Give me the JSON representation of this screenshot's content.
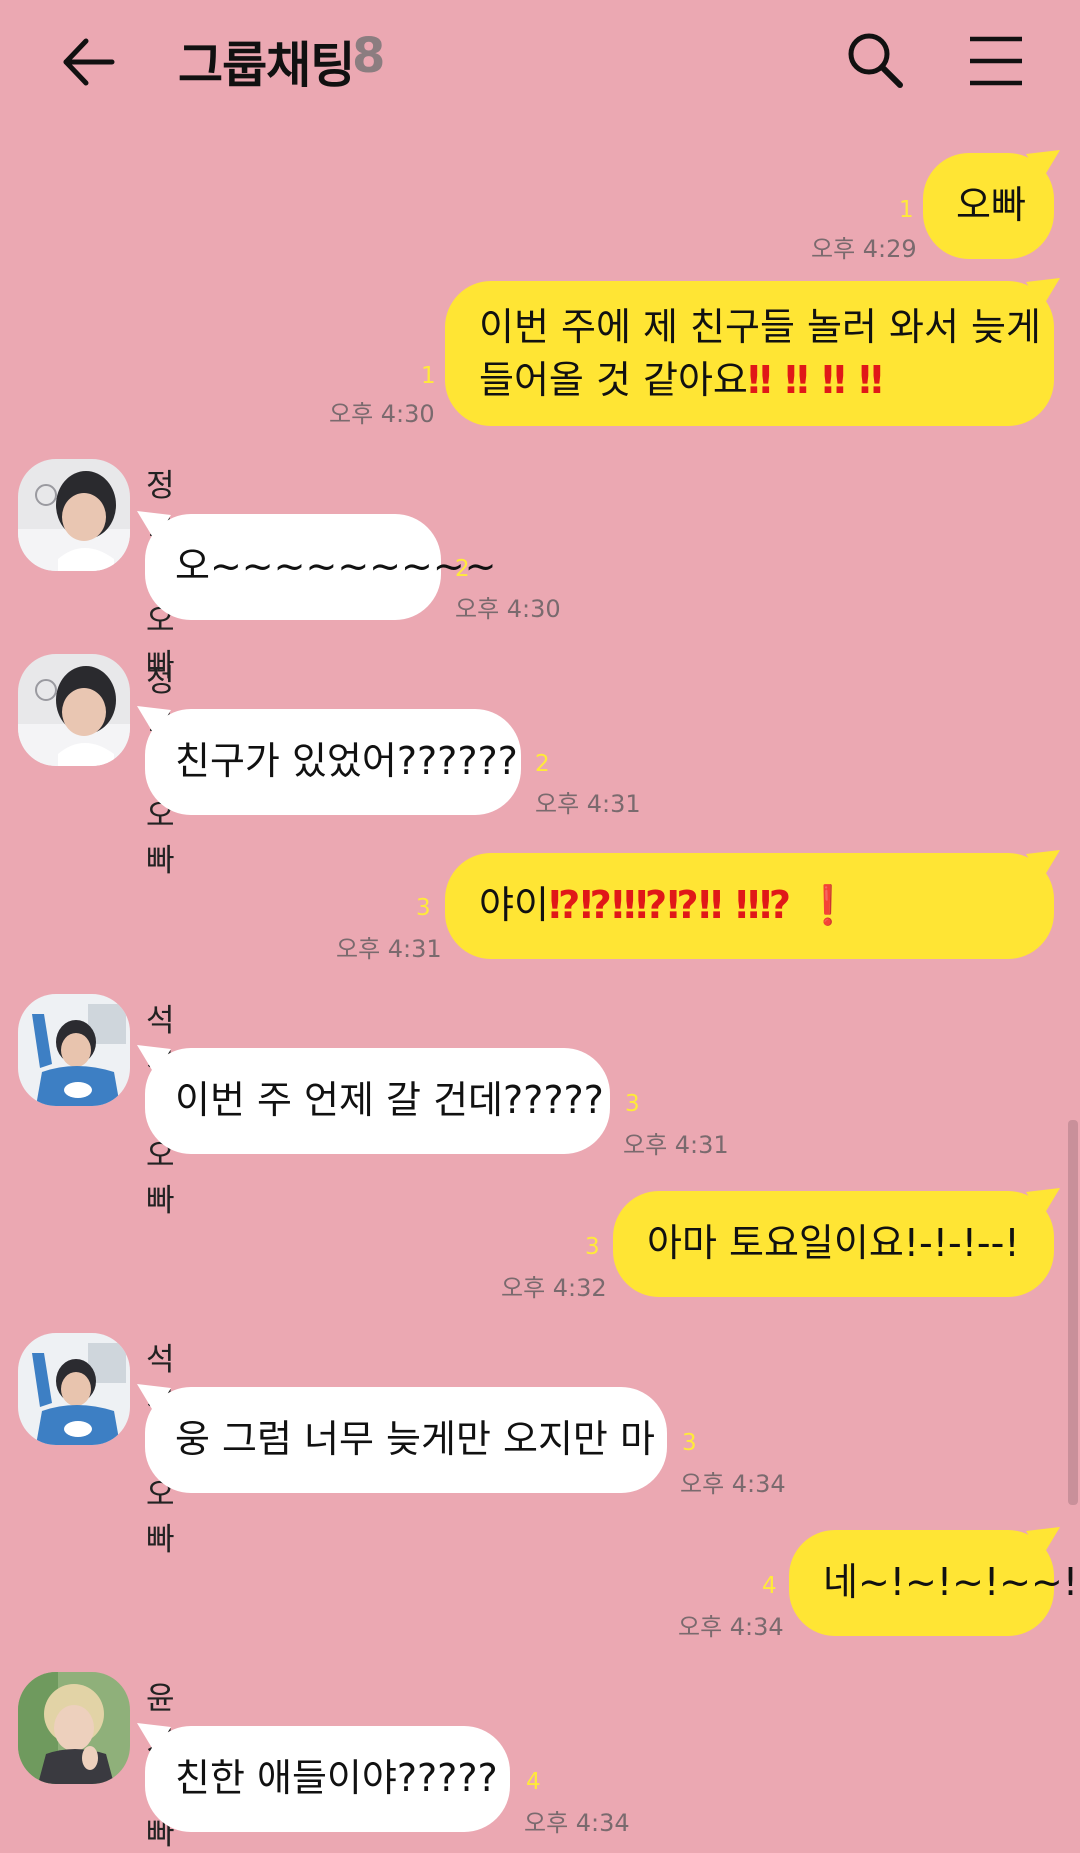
{
  "header": {
    "title": "그룹채팅",
    "member_count": "8",
    "back_icon": "arrow-left-icon",
    "search_icon": "search-icon",
    "menu_icon": "hamburger-menu-icon"
  },
  "colors": {
    "background": "#eba8b2",
    "my_bubble": "#ffe534",
    "other_bubble": "#ffffff",
    "unread": "#ffea3a",
    "emphasis": "#e01818"
  },
  "messages": [
    {
      "from": "me",
      "text": "오빠",
      "unread": "1",
      "time": "오후 4:29"
    },
    {
      "from": "me",
      "line1": "이번 주에 제 친구들 놀러 와서 늦게",
      "line2": "들어올 것 같아요",
      "emphasis": "‼ ‼ ‼ ‼",
      "unread": "1",
      "time": "오후 4:30"
    },
    {
      "from": "정국이오빠",
      "sender": "정국이오빠",
      "text": "오~~~~~~~~~",
      "unread": "2",
      "time": "오후 4:30"
    },
    {
      "from": "정국이오빠",
      "sender": "정국이오빠",
      "text": "친구가 있었어??????",
      "unread": "2",
      "time": "오후 4:31"
    },
    {
      "from": "me",
      "text": "야이",
      "emphasis": "⁉⁉‼⁉⁉‼ ‼⁉ ❗",
      "unread": "3",
      "time": "오후 4:31"
    },
    {
      "from": "석진이오빠",
      "sender": "석진이오빠",
      "text": "이번 주 언제 갈 건데?????",
      "unread": "3",
      "time": "오후 4:31"
    },
    {
      "from": "me",
      "text": "아마 토요일이요!-!-!--!",
      "unread": "3",
      "time": "오후 4:32"
    },
    {
      "from": "석진이오빠",
      "sender": "석진이오빠",
      "text": "웅 그럼 너무 늦게만 오지만 마",
      "unread": "3",
      "time": "오후 4:34"
    },
    {
      "from": "me",
      "text": "네~!~!~!~~!",
      "unread": "4",
      "time": "오후 4:34"
    },
    {
      "from": "윤기오빠",
      "sender": "윤기오빠",
      "text": "친한 애들이야?????",
      "unread": "4",
      "time": "오후 4:34"
    }
  ]
}
